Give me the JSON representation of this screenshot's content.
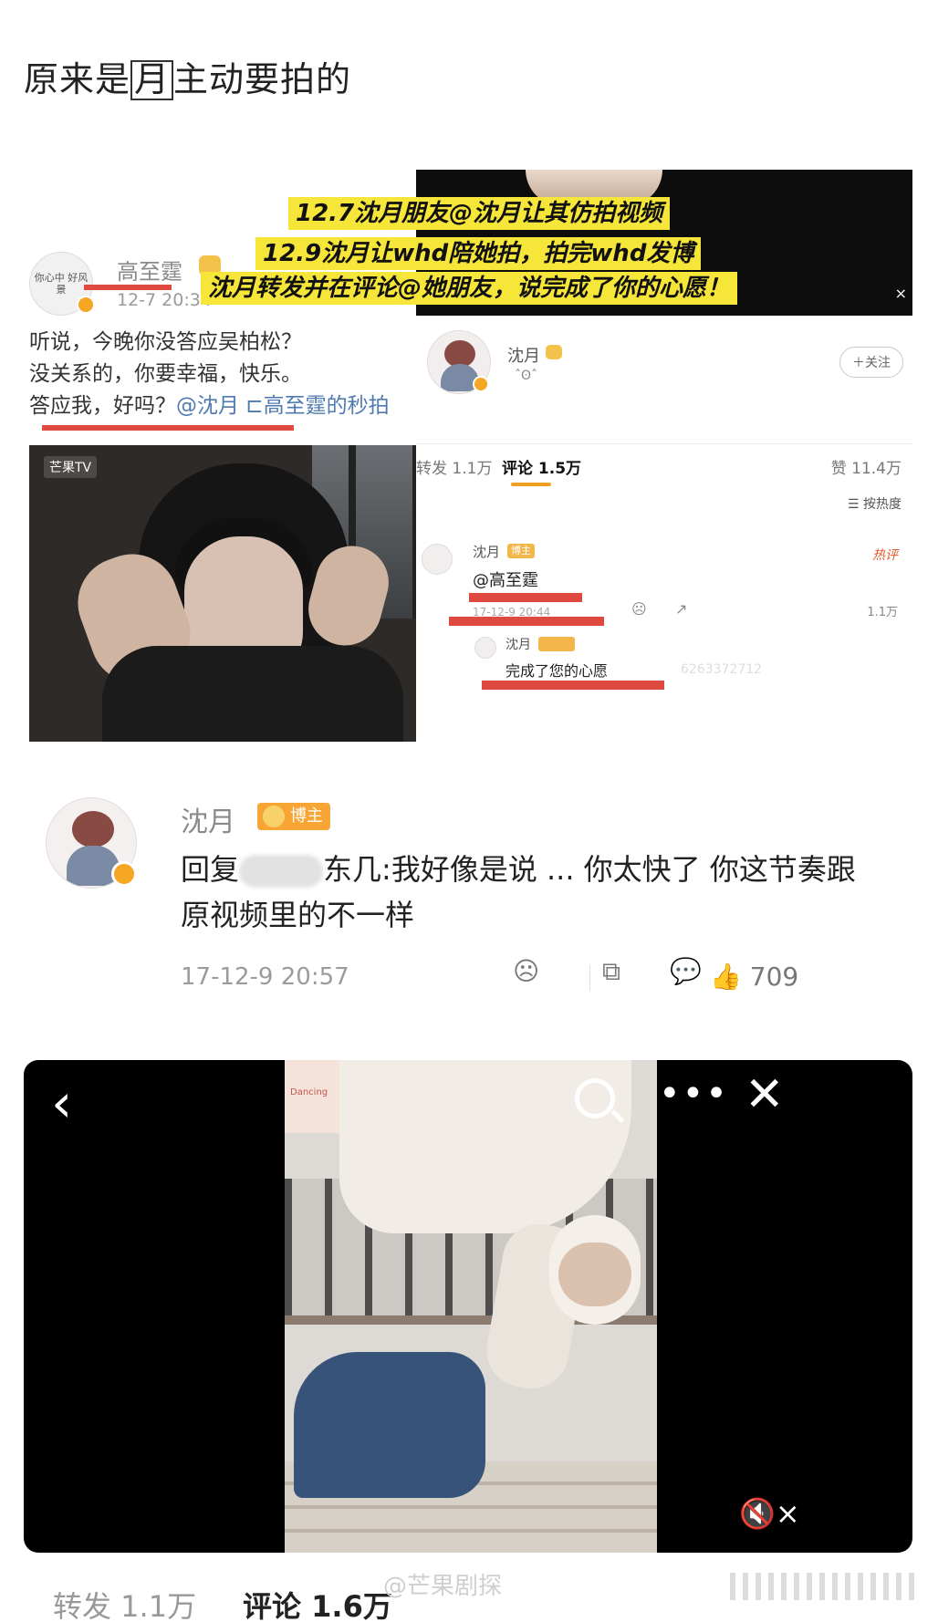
{
  "post_title_parts": [
    "原来是",
    "月",
    "主动要拍的"
  ],
  "collage": {
    "left_post": {
      "name": "高至霆",
      "time": "12-7 20:34",
      "avatar_text": "你心中\n好风景",
      "lines": [
        "听说，今晚你没答应吴柏松？",
        "没关系的，你要幸福，快乐。"
      ],
      "line3_prefix": "答应我，好吗？",
      "line3_mention": "@沈月",
      "line3_suffix": " ⊏高至霆的秒拍",
      "video_logo": "芒果TV"
    },
    "callouts": [
      "12.7沈月朋友@沈月让其仿拍视频",
      "12.9沈月让whd陪她拍，拍完whd发博",
      "沈月转发并在评论@她朋友，说完成了你的心愿！"
    ],
    "callout_close": "×",
    "right_post": {
      "name": "沈月",
      "sub": "ˆʘˆ",
      "follow": "＋关注",
      "tabs": [
        "转发 1.1万",
        "评论 1.5万",
        "赞 11.4万"
      ],
      "sort": "☰ 按热度",
      "comment_name": "沈月",
      "comment_badge": "博主",
      "hot": "热评",
      "comment_text": "@高至霆",
      "comment_time": "17-12-9 20:44",
      "comment_likes": "1.1万",
      "reply_name": "沈月",
      "reply_text": "完成了您的心愿",
      "reply_faint": "6263372712"
    }
  },
  "comment": {
    "name": "沈月",
    "badge": "博主",
    "reply_prefix": "回复",
    "reply_blurred_tail": "东几",
    "reply_body": ":我好像是说 ... 你太快了 你这节奏跟原视频里的不一样",
    "time": "17-12-9 20:57",
    "likes": "709"
  },
  "player": {
    "back": "‹",
    "more": "•••",
    "close": "✕",
    "mute": "🔇×",
    "banner": "Dancing"
  },
  "bottom_tabs": [
    "转发 1.1万",
    "评论 1.6万"
  ],
  "watermark": "@芒果剧探"
}
